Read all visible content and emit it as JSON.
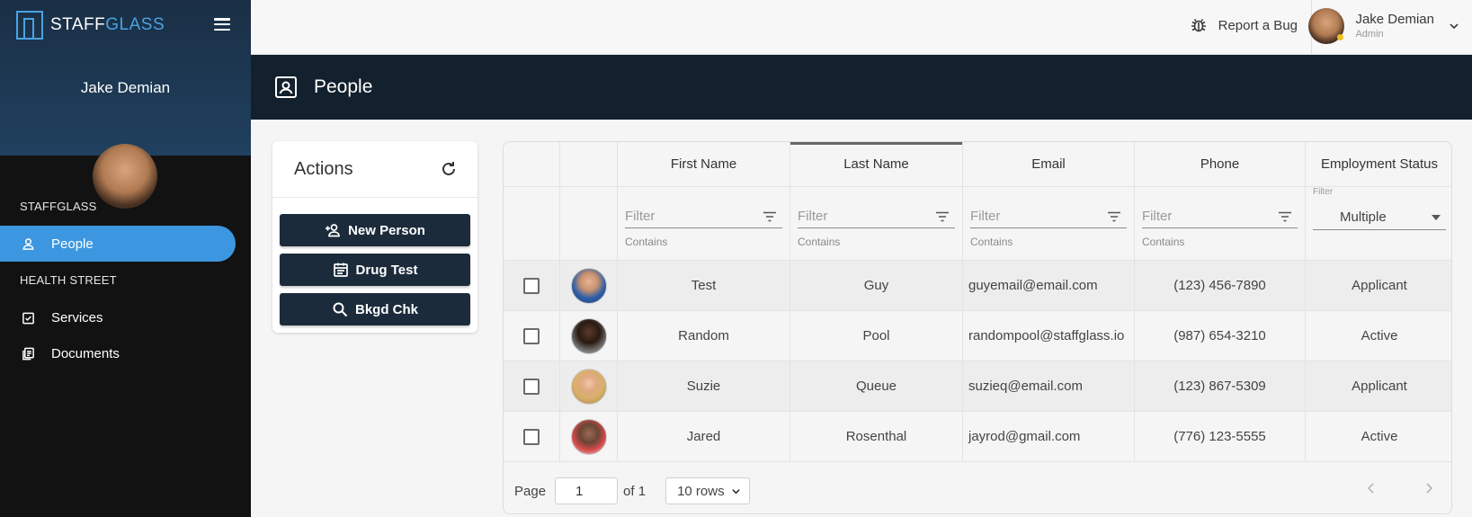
{
  "brand": {
    "name_part1": "STAFF",
    "name_part2": "GLASS",
    "accent_color": "#4aa3e0"
  },
  "sidebar": {
    "user_name": "Jake Demian",
    "sections": [
      {
        "title": "STAFFGLASS",
        "items": [
          {
            "label": "People",
            "icon": "person-icon",
            "active": true
          }
        ]
      },
      {
        "title": "HEALTH STREET",
        "items": [
          {
            "label": "Services",
            "icon": "clipboard-check-icon",
            "active": false
          },
          {
            "label": "Documents",
            "icon": "documents-icon",
            "active": false
          }
        ]
      }
    ]
  },
  "topbar": {
    "report_bug_label": "Report a Bug",
    "user_name": "Jake Demian",
    "user_role": "Admin"
  },
  "page": {
    "title": "People",
    "icon": "contact-card-icon"
  },
  "actions": {
    "title": "Actions",
    "buttons": [
      {
        "label": "New Person",
        "icon": "add-person-icon"
      },
      {
        "label": "Drug Test",
        "icon": "calendar-icon"
      },
      {
        "label": "Bkgd Chk",
        "icon": "search-icon"
      }
    ]
  },
  "table": {
    "columns": [
      "First Name",
      "Last Name",
      "Email",
      "Phone",
      "Employment Status"
    ],
    "sorted_column": "Last Name",
    "filter_placeholder": "Filter",
    "filter_hint": "Contains",
    "status_filter": {
      "label": "Filter",
      "value": "Multiple"
    },
    "rows": [
      {
        "first": "Test",
        "last": "Guy",
        "email": "guyemail@email.com",
        "phone": "(123) 456-7890",
        "status": "Applicant"
      },
      {
        "first": "Random",
        "last": "Pool",
        "email": "randompool@staffglass.io",
        "phone": "(987) 654-3210",
        "status": "Active"
      },
      {
        "first": "Suzie",
        "last": "Queue",
        "email": "suzieq@email.com",
        "phone": "(123) 867-5309",
        "status": "Applicant"
      },
      {
        "first": "Jared",
        "last": "Rosenthal",
        "email": "jayrod@gmail.com",
        "phone": "(776) 123-5555",
        "status": "Active"
      }
    ],
    "pagination": {
      "page_label": "Page",
      "page_value": "1",
      "of_label": "of 1",
      "rows_label": "10 rows"
    }
  }
}
